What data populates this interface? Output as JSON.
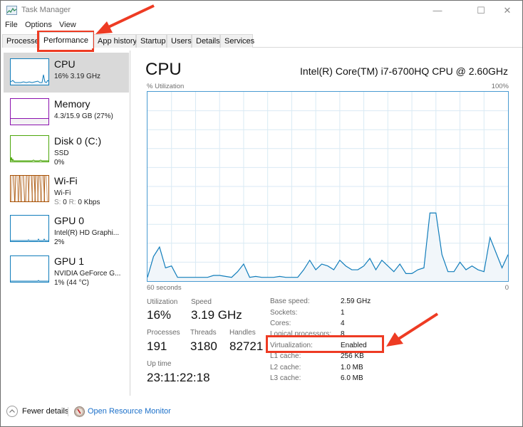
{
  "window": {
    "title": "Task Manager",
    "controls": {
      "minimize": "—",
      "maximize": "☐",
      "close": "✕"
    }
  },
  "menu": [
    "File",
    "Options",
    "View"
  ],
  "tabs": [
    {
      "label": "Processes",
      "active": false
    },
    {
      "label": "Performance",
      "active": true
    },
    {
      "label": "App history",
      "active": false
    },
    {
      "label": "Startup",
      "active": false
    },
    {
      "label": "Users",
      "active": false
    },
    {
      "label": "Details",
      "active": false
    },
    {
      "label": "Services",
      "active": false
    }
  ],
  "sidebar": {
    "items": [
      {
        "title": "CPU",
        "lines": [
          "16% 3.19 GHz"
        ],
        "color": "#117dbb",
        "selected": true
      },
      {
        "title": "Memory",
        "lines": [
          "4.3/15.9 GB (27%)"
        ],
        "color": "#8b12ae",
        "selected": false
      },
      {
        "title": "Disk 0 (C:)",
        "lines": [
          "SSD",
          "0%"
        ],
        "color": "#4da60c",
        "selected": false
      },
      {
        "title": "Wi-Fi",
        "lines": [
          "Wi-Fi",
          "S: 0 R: 0 Kbps"
        ],
        "color": "#a74f01",
        "selected": false
      },
      {
        "title": "GPU 0",
        "lines": [
          "Intel(R) HD Graphi...",
          "2%"
        ],
        "color": "#117dbb",
        "selected": false
      },
      {
        "title": "GPU 1",
        "lines": [
          "NVIDIA GeForce G...",
          "1% (44 °C)"
        ],
        "color": "#117dbb",
        "selected": false
      }
    ],
    "wifi_sublabels": {
      "send_prefix": "S:",
      "send": "0",
      "recv_prefix": "R:",
      "recv": "0 Kbps"
    }
  },
  "main": {
    "title": "CPU",
    "model": "Intel(R) Core(TM) i7-6700HQ CPU @ 2.60GHz",
    "colors": {
      "line": "#117dbb",
      "fill": "#f1f6fa",
      "grid": "#d9eaf4",
      "border": "#4a9bd1"
    }
  },
  "chart_data": {
    "type": "area",
    "title": "CPU",
    "ylabel": "% Utilization",
    "ymax_label": "100%",
    "xlabel_left": "60 seconds",
    "xlabel_right": "0",
    "xlim": [
      60,
      0
    ],
    "ylim": [
      0,
      100
    ],
    "grid": true,
    "grid_columns": 15,
    "grid_rows": 10,
    "series": [
      {
        "name": "CPU utilization",
        "values": [
          2,
          13,
          18,
          7,
          8,
          2,
          2,
          2,
          2,
          2,
          2,
          3,
          3,
          2.5,
          2,
          5,
          9,
          2,
          2.5,
          2,
          2,
          2,
          2.5,
          2,
          2,
          2,
          6,
          11,
          6,
          9,
          8,
          6,
          11,
          8,
          6,
          6,
          8,
          12,
          6,
          11,
          8,
          5,
          9,
          4,
          4,
          6,
          7,
          36,
          36,
          14,
          5,
          5,
          10,
          6,
          8,
          6,
          5,
          23,
          15,
          7,
          14
        ]
      }
    ]
  },
  "stats": {
    "utilization": {
      "label": "Utilization",
      "value": "16%"
    },
    "speed": {
      "label": "Speed",
      "value": "3.19 GHz"
    },
    "processes": {
      "label": "Processes",
      "value": "191"
    },
    "threads": {
      "label": "Threads",
      "value": "3180"
    },
    "handles": {
      "label": "Handles",
      "value": "82721"
    },
    "uptime": {
      "label": "Up time",
      "value": "23:11:22:18"
    }
  },
  "specs": [
    {
      "label": "Base speed:",
      "value": "2.59 GHz"
    },
    {
      "label": "Sockets:",
      "value": "1"
    },
    {
      "label": "Cores:",
      "value": "4"
    },
    {
      "label": "Logical processors:",
      "value": "8"
    },
    {
      "label": "Virtualization:",
      "value": "Enabled"
    },
    {
      "label": "L1 cache:",
      "value": "256 KB"
    },
    {
      "label": "L2 cache:",
      "value": "1.0 MB"
    },
    {
      "label": "L3 cache:",
      "value": "6.0 MB"
    }
  ],
  "footer": {
    "fewer_details": "Fewer details",
    "open_resource_monitor": "Open Resource Monitor"
  },
  "annotations": {
    "highlight_color": "#ee3b23"
  }
}
